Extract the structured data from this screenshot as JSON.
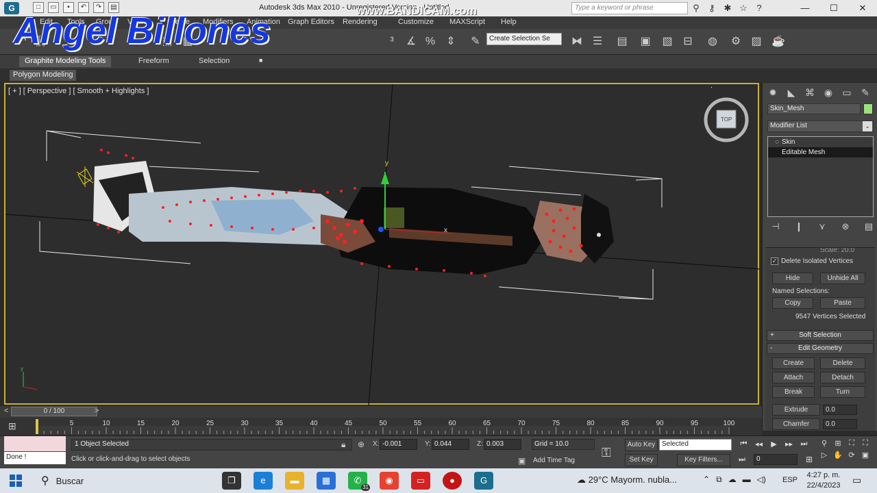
{
  "window": {
    "title": "Autodesk 3ds Max  2010  -  Unregistered Version  - Untitled",
    "search_placeholder": "Type a keyword or phrase",
    "min_label": "—",
    "max_label": "☐",
    "close_label": "✕"
  },
  "overlay": {
    "watermark": "Angel Billones",
    "recorder": "www.BANDICAM.com"
  },
  "menu": {
    "items": [
      "Edit",
      "Tools",
      "Group",
      "Views",
      "Create",
      "Modifiers",
      "Animation",
      "Graph Editors",
      "Rendering",
      "Customize",
      "MAXScript",
      "Help"
    ]
  },
  "toolbar": {
    "selection_set_placeholder": "Create Selection Se"
  },
  "ribbon": {
    "tabs": [
      "Graphite Modeling Tools",
      "Freeform",
      "Selection"
    ],
    "active_tab": "Graphite Modeling Tools",
    "extra_icon": "■",
    "panel_label": "Polygon Modeling"
  },
  "viewport": {
    "label": "[ + ] [ Perspective ] [ Smooth + Highlights ]",
    "viewcube_label": "TOP"
  },
  "command_panel": {
    "object_name": "Skin_Mesh",
    "object_color": "#9be07e",
    "modifier_list": "Modifier List",
    "stack": [
      "Skin",
      "Editable Mesh"
    ],
    "scale_label": "Scale: 20.0",
    "delete_isolated": "Delete Isolated Vertices",
    "hide": "Hide",
    "unhide_all": "Unhide All",
    "named_selections": "Named Selections:",
    "copy": "Copy",
    "paste": "Paste",
    "selection_status": "9547 Vertices Selected",
    "soft_selection": "Soft Selection",
    "soft_selection_toggle": "+",
    "edit_geometry": "Edit Geometry",
    "edit_geometry_toggle": "-",
    "create": "Create",
    "delete": "Delete",
    "attach": "Attach",
    "detach": "Detach",
    "break": "Break",
    "turn": "Turn",
    "extrude": "Extrude",
    "extrude_value": "0.0",
    "chamfer": "Chamfer",
    "chamfer_value": "0.0"
  },
  "timeline": {
    "frame_display": "0 / 100",
    "ticks": [
      "5",
      "10",
      "15",
      "20",
      "25",
      "30",
      "35",
      "40",
      "45",
      "50",
      "55",
      "60",
      "65",
      "70",
      "75",
      "80",
      "85",
      "90",
      "95",
      "100"
    ]
  },
  "status": {
    "maxscript_output": "Done !",
    "selection": "1 Object Selected",
    "prompt": "Click or click-and-drag to select objects",
    "x_label": "X:",
    "x": "-0.001",
    "y_label": "Y:",
    "y": "0.044",
    "z_label": "Z:",
    "z": "0.003",
    "grid": "Grid = 10.0",
    "add_time_tag": "Add Time Tag",
    "auto_key": "Auto Key",
    "set_key": "Set Key",
    "selected_dropdown": "Selected",
    "key_filters": "Key Filters...",
    "current_frame": "0"
  },
  "taskbar": {
    "search_label": "Buscar",
    "weather": "29°C  Mayorm. nubla...",
    "language": "ESP",
    "time": "4:27 p. m.",
    "date": "22/4/2023",
    "whatsapp_badge": "31"
  }
}
